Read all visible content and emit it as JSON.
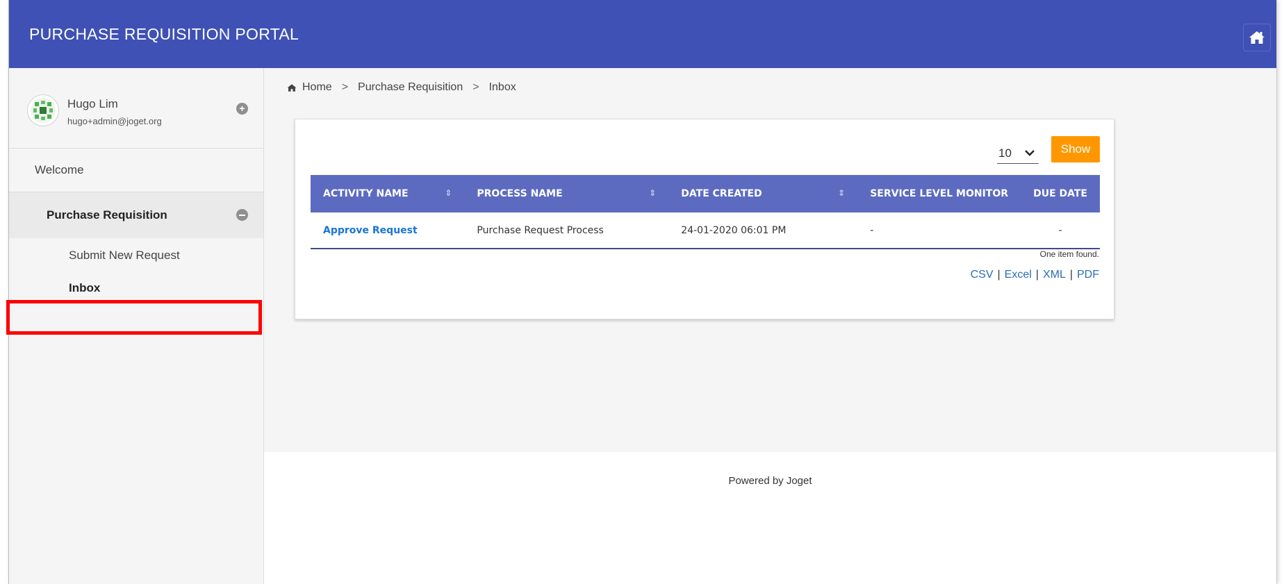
{
  "header": {
    "title": "PURCHASE REQUISITION PORTAL",
    "home_icon": "home-icon"
  },
  "user": {
    "name": "Hugo Lim",
    "email": "hugo+admin@joget.org"
  },
  "sidebar": {
    "items": [
      {
        "label": "Welcome"
      },
      {
        "label": "Purchase Requisition"
      },
      {
        "label": "Submit New Request"
      },
      {
        "label": "Inbox"
      }
    ]
  },
  "breadcrumb": {
    "items": [
      "Home",
      "Purchase Requisition",
      "Inbox"
    ],
    "separator": ">"
  },
  "list": {
    "page_size": "10",
    "show_label": "Show",
    "columns": [
      "ACTIVITY NAME",
      "PROCESS NAME",
      "DATE CREATED",
      "SERVICE LEVEL MONITOR",
      "DUE DATE"
    ],
    "rows": [
      {
        "activity": "Approve Request",
        "process": "Purchase Request Process",
        "date": "24-01-2020 06:01 PM",
        "slm": "-",
        "due": "-"
      }
    ],
    "status": "One item found.",
    "exports": [
      "CSV",
      "Excel",
      "XML",
      "PDF"
    ]
  },
  "footer": {
    "text": "Powered by Joget"
  },
  "colors": {
    "header": "#3f51b5",
    "table_header": "#5c6bc0",
    "show_button": "#ff9800",
    "link": "#1976d2",
    "highlight": "#ff0000"
  }
}
